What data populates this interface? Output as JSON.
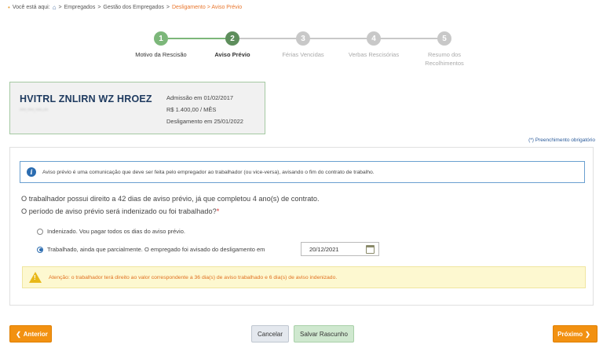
{
  "breadcrumb": {
    "prefix": "Você está aqui:",
    "items": [
      "Empregados",
      "Gestão dos Empregados"
    ],
    "current": "Desligamento > Aviso Prévio",
    "separator": ">"
  },
  "stepper": {
    "steps": [
      {
        "number": "1",
        "label": "Motivo da Rescisão",
        "state": "done"
      },
      {
        "number": "2",
        "label": "Aviso Prévio",
        "state": "active"
      },
      {
        "number": "3",
        "label": "Férias Vencidas",
        "state": "pending"
      },
      {
        "number": "4",
        "label": "Verbas Rescisórias",
        "state": "pending"
      },
      {
        "number": "5",
        "label": "Resumo dos Recolhimentos",
        "state": "pending"
      }
    ]
  },
  "employee": {
    "name": "HVITRL ZNLIRN WZ HROEZ",
    "cpf": "***.***.***-**",
    "admission": "Admissão em 01/02/2017",
    "salary": "R$ 1.400,00 / MÊS",
    "termination": "Desligamento em 25/01/2022"
  },
  "required_note": "(*) Preenchimento obrigatório",
  "info": {
    "text": "Aviso prévio é uma comunicação que deve ser feita pelo empregador ao trabalhador (ou vice-versa), avisando o fim do contrato de trabalho."
  },
  "question": {
    "line1_a": "O trabalhador possui direito a ",
    "line1_days": "42",
    "line1_b": " dias de aviso prévio, já que completou ",
    "line1_years": "4",
    "line1_c": " ano(s) de contrato.",
    "line2": "O período de aviso prévio será indenizado ou foi trabalhado?",
    "required_mark": "*"
  },
  "options": {
    "indenizado": "Indenizado. Vou pagar todos os dias do aviso prévio.",
    "trabalhado": "Trabalhado, ainda que parcialmente. O empregado foi avisado do desligamento em",
    "selected": "trabalhado"
  },
  "date_field": {
    "value": "20/12/2021"
  },
  "warning": {
    "text": "Atenção: o trabalhador terá direito ao valor correspondente a 36 dia(s) de aviso trabalhado e 6 dia(s) de aviso indenizado."
  },
  "buttons": {
    "previous": "Anterior",
    "cancel": "Cancelar",
    "save_draft": "Salvar Rascunho",
    "next": "Próximo"
  },
  "colors": {
    "accent_orange": "#f29111",
    "step_done": "#7cb77a",
    "step_active": "#5e8e5c",
    "step_pending": "#c8c8c8"
  }
}
